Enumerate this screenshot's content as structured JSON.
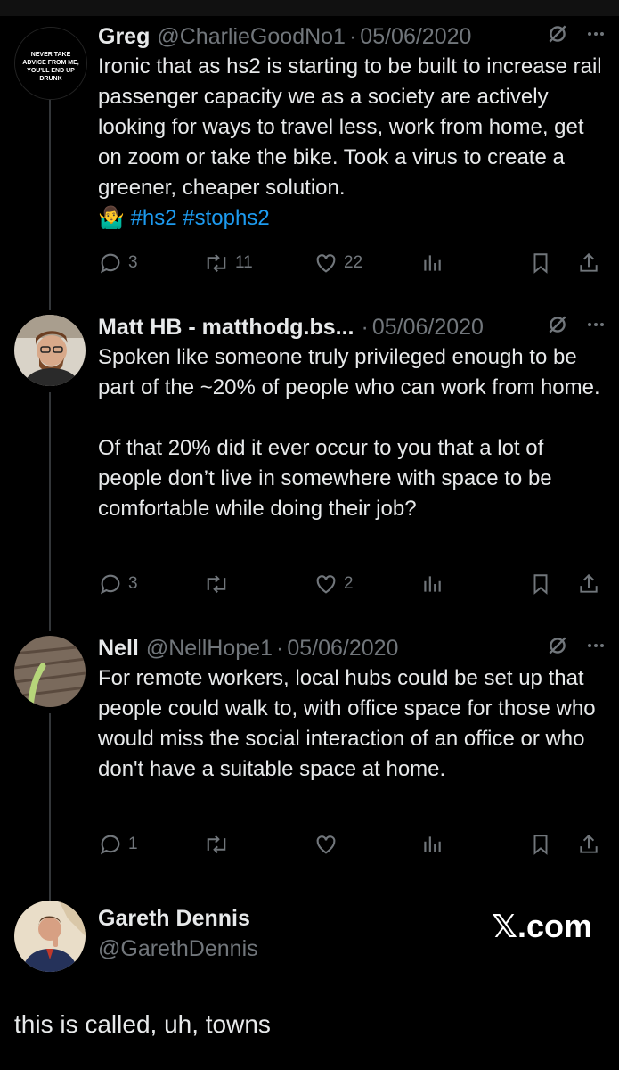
{
  "tweets": [
    {
      "name": "Greg",
      "handle": "@CharlieGoodNo1",
      "date": "05/06/2020",
      "avatar_caption": "NEVER TAKE ADVICE FROM ME, YOU'LL END UP DRUNK",
      "text": "Ironic that as hs2 is starting to be built to increase rail passenger capacity we as a society are actively looking for ways to travel less, work from home, get on zoom or take the bike. Took a virus to create a greener, cheaper solution.",
      "emoji": "🤷‍♂️",
      "hashtags": [
        "#hs2",
        "#stophs2"
      ],
      "replies": "3",
      "retweets": "11",
      "likes": "22"
    },
    {
      "name": "Matt HB - matthodg.bs...",
      "handle": "",
      "date": "05/06/2020",
      "text": "Spoken like someone truly privileged enough to be part of the ~20% of people who can work from home.\n\nOf that 20% did it ever occur to you that a lot of people don’t live in somewhere with space to be comfortable while doing their job?",
      "replies": "3",
      "retweets": "",
      "likes": "2"
    },
    {
      "name": "Nell",
      "handle": "@NellHope1",
      "date": "05/06/2020",
      "text": "For remote workers, local hubs could be set up that people could walk to, with office space for those who would miss the social interaction of an office or who don't have a suitable space at home.",
      "replies": "1",
      "retweets": "",
      "likes": ""
    }
  ],
  "quote": {
    "name": "Gareth Dennis",
    "handle": "@GarethDennis",
    "brand": "𝕏.com",
    "text": "this is called, uh, towns"
  },
  "icons": {
    "reply": "reply-icon",
    "retweet": "retweet-icon",
    "like": "heart-icon",
    "views": "views-icon",
    "bookmark": "bookmark-icon",
    "share": "share-icon",
    "grok": "slash-circle-icon",
    "more": "more-icon"
  },
  "colors": {
    "background": "#000000",
    "text": "#e7e9ea",
    "secondary": "#71767b",
    "link": "#1d9bf0"
  }
}
